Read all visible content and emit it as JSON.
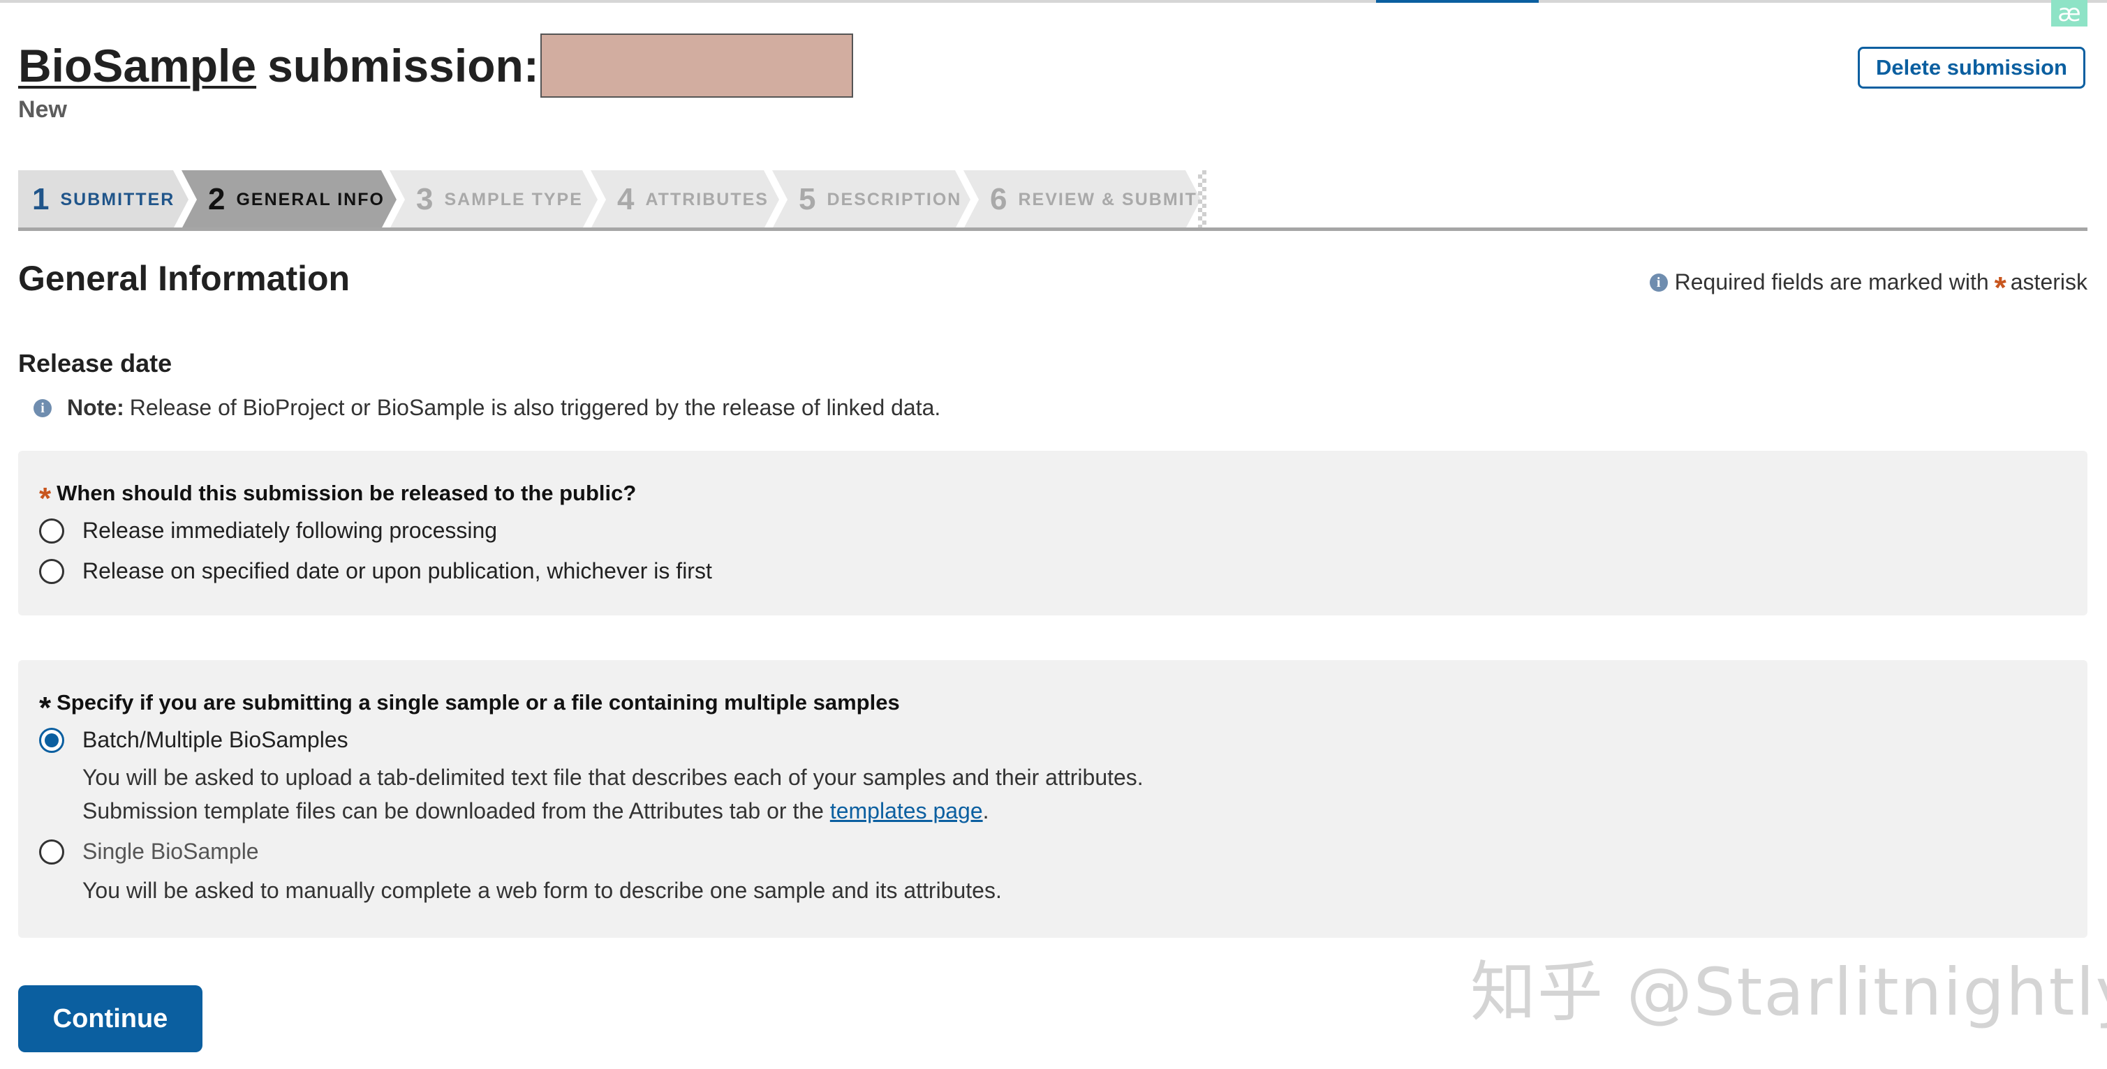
{
  "header": {
    "title_link": "BioSample",
    "title_rest": "submission:",
    "status": "New",
    "delete_label": "Delete submission",
    "corner_badge": "æ"
  },
  "steps": [
    {
      "num": "1",
      "label": "SUBMITTER",
      "state": "done"
    },
    {
      "num": "2",
      "label": "GENERAL INFO",
      "state": "active"
    },
    {
      "num": "3",
      "label": "SAMPLE TYPE",
      "state": "todo"
    },
    {
      "num": "4",
      "label": "ATTRIBUTES",
      "state": "todo"
    },
    {
      "num": "5",
      "label": "DESCRIPTION",
      "state": "todo"
    },
    {
      "num": "6",
      "label": "REVIEW & SUBMIT",
      "state": "todo"
    }
  ],
  "main": {
    "section_title": "General Information",
    "required_note_prefix": "Required fields are marked with",
    "required_note_suffix": "asterisk",
    "release_title": "Release date",
    "note_label": "Note:",
    "note_text": "Release of BioProject or BioSample is also triggered by the release of linked data.",
    "release_question": "When should this submission be released to the public?",
    "release_options": [
      {
        "label": "Release immediately following processing",
        "checked": false
      },
      {
        "label": "Release on specified date or upon publication, whichever is first",
        "checked": false
      }
    ],
    "sample_question": "Specify if you are submitting a single sample or a file containing multiple samples",
    "sample_options": [
      {
        "label": "Batch/Multiple BioSamples",
        "checked": true,
        "desc_before_link": "You will be asked to upload a tab-delimited text file that describes each of your samples and their attributes. Submission template files can be downloaded from the Attributes tab or the",
        "link_text": "templates page",
        "desc_after_link": "."
      },
      {
        "label": "Single BioSample",
        "checked": false,
        "desc": "You will be asked to manually complete a web form to describe one sample and its attributes."
      }
    ],
    "continue_label": "Continue",
    "asterisk": "*"
  },
  "watermark": "知乎 @Starlitnightly",
  "colors": {
    "accent": "#0b5fa0",
    "required": "#c8561e",
    "panel": "#f1f1f1"
  }
}
